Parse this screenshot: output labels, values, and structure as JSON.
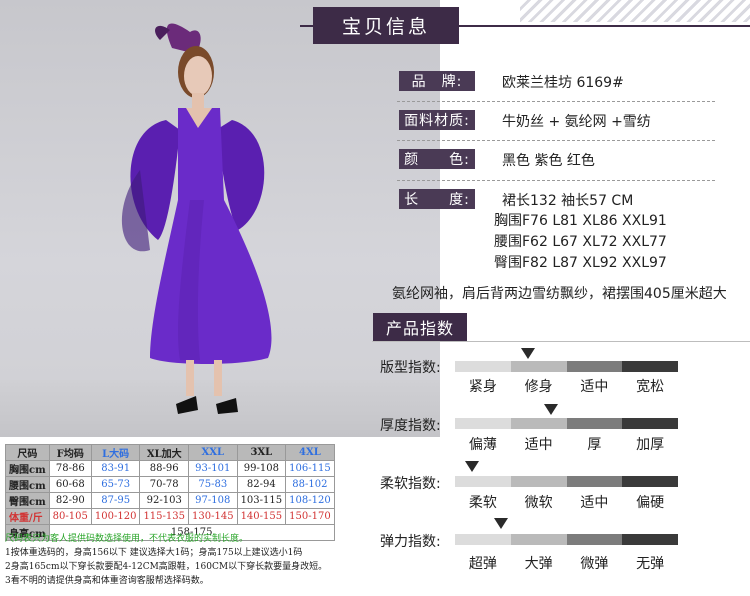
{
  "header": {
    "title": "宝贝信息"
  },
  "specs": [
    {
      "label": "品　牌:",
      "value": "欧莱兰桂坊  6169#"
    },
    {
      "label": "面料材质:",
      "value": "牛奶丝 + 氨纶网 +雪纺"
    },
    {
      "label": "颜　　色:",
      "value": "黑色 紫色 红色"
    },
    {
      "label": "长　　度:",
      "value": "裙长132 袖长57 CM"
    }
  ],
  "sizes_lines": [
    "胸围F76 L81 XL86 XXL91",
    "腰围F62 L67 XL72 XXL77",
    "臀围F82 L87 XL92 XXL97"
  ],
  "note": "氨纶网袖，肩后背两边雪纺飘纱，裙摆围405厘米超大",
  "index": {
    "title": "产品指数",
    "rows": [
      {
        "label": "版型指数:",
        "words": [
          "紧身",
          "修身",
          "适中",
          "宽松"
        ],
        "level": 0.33
      },
      {
        "label": "厚度指数:",
        "words": [
          "偏薄",
          "适中",
          "厚",
          "加厚"
        ],
        "level": 0.43
      },
      {
        "label": "柔软指数:",
        "words": [
          "柔软",
          "微软",
          "适中",
          "偏硬"
        ],
        "level": 0.07
      },
      {
        "label": "弹力指数:",
        "words": [
          "超弹",
          "大弹",
          "微弹",
          "无弹"
        ],
        "level": 0.21
      }
    ]
  },
  "size_table": {
    "headers": [
      "尺码",
      "F均码",
      "L大码",
      "XL加大",
      "XXL",
      "3XL",
      "4XL"
    ],
    "rows": [
      {
        "label": "胸围cm",
        "values": [
          "78-86",
          "83-91",
          "88-96",
          "93-101",
          "99-108",
          "106-115"
        ]
      },
      {
        "label": "腰围cm",
        "values": [
          "60-68",
          "65-73",
          "70-78",
          "75-83",
          "82-94",
          "88-102"
        ]
      },
      {
        "label": "臀围cm",
        "values": [
          "82-90",
          "87-95",
          "92-103",
          "97-108",
          "103-115",
          "108-120"
        ]
      },
      {
        "label": "体重/斤",
        "values": [
          "80-105",
          "100-120",
          "115-135",
          "130-145",
          "140-155",
          "150-170"
        ]
      }
    ],
    "height_label": "身高cm",
    "height_value": "158-175"
  },
  "table_notes": [
    "尺码表只为客人提供码数选择使用，不代表衣服的实制长度。",
    "1按体重选码的，身高156以下 建议选择大1码；身高175以上建议选小1码",
    "2身高165cm以下穿长款要配4-12CM高跟鞋，160CM以下穿长款要量身改短。",
    "3看不明的请提供身高和体重咨询客服帮选择码数。"
  ],
  "colors": {
    "accent": "#3d2b47",
    "dress": "#6a2bc9",
    "warn": "#d23333",
    "blue": "#2f6fe0",
    "green": "#2aa52a"
  }
}
